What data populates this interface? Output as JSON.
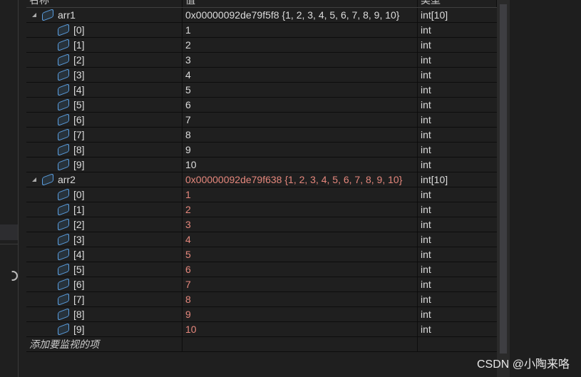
{
  "headers": {
    "name": "名称",
    "value": "值",
    "type": "类型"
  },
  "rows": [
    {
      "name": "arr1",
      "value": "0x00000092de79f5f8 {1, 2, 3, 4, 5, 6, 7, 8, 9, 10}",
      "type": "int[10]",
      "level": 0,
      "changed": false
    },
    {
      "name": "[0]",
      "value": "1",
      "type": "int",
      "level": 1,
      "changed": false
    },
    {
      "name": "[1]",
      "value": "2",
      "type": "int",
      "level": 1,
      "changed": false
    },
    {
      "name": "[2]",
      "value": "3",
      "type": "int",
      "level": 1,
      "changed": false
    },
    {
      "name": "[3]",
      "value": "4",
      "type": "int",
      "level": 1,
      "changed": false
    },
    {
      "name": "[4]",
      "value": "5",
      "type": "int",
      "level": 1,
      "changed": false
    },
    {
      "name": "[5]",
      "value": "6",
      "type": "int",
      "level": 1,
      "changed": false
    },
    {
      "name": "[6]",
      "value": "7",
      "type": "int",
      "level": 1,
      "changed": false
    },
    {
      "name": "[7]",
      "value": "8",
      "type": "int",
      "level": 1,
      "changed": false
    },
    {
      "name": "[8]",
      "value": "9",
      "type": "int",
      "level": 1,
      "changed": false
    },
    {
      "name": "[9]",
      "value": "10",
      "type": "int",
      "level": 1,
      "changed": false
    },
    {
      "name": "arr2",
      "value": "0x00000092de79f638 {1, 2, 3, 4, 5, 6, 7, 8, 9, 10}",
      "type": "int[10]",
      "level": 0,
      "changed": true
    },
    {
      "name": "[0]",
      "value": "1",
      "type": "int",
      "level": 1,
      "changed": true
    },
    {
      "name": "[1]",
      "value": "2",
      "type": "int",
      "level": 1,
      "changed": true
    },
    {
      "name": "[2]",
      "value": "3",
      "type": "int",
      "level": 1,
      "changed": true
    },
    {
      "name": "[3]",
      "value": "4",
      "type": "int",
      "level": 1,
      "changed": true
    },
    {
      "name": "[4]",
      "value": "5",
      "type": "int",
      "level": 1,
      "changed": true
    },
    {
      "name": "[5]",
      "value": "6",
      "type": "int",
      "level": 1,
      "changed": true
    },
    {
      "name": "[6]",
      "value": "7",
      "type": "int",
      "level": 1,
      "changed": true
    },
    {
      "name": "[7]",
      "value": "8",
      "type": "int",
      "level": 1,
      "changed": true
    },
    {
      "name": "[8]",
      "value": "9",
      "type": "int",
      "level": 1,
      "changed": true
    },
    {
      "name": "[9]",
      "value": "10",
      "type": "int",
      "level": 1,
      "changed": true
    }
  ],
  "add_placeholder": "添加要监视的项",
  "watermark": "CSDN @小陶来咯",
  "colors": {
    "changed": "#e5877c",
    "text": "#dcdcdc",
    "icon": "#5a9ee0"
  }
}
